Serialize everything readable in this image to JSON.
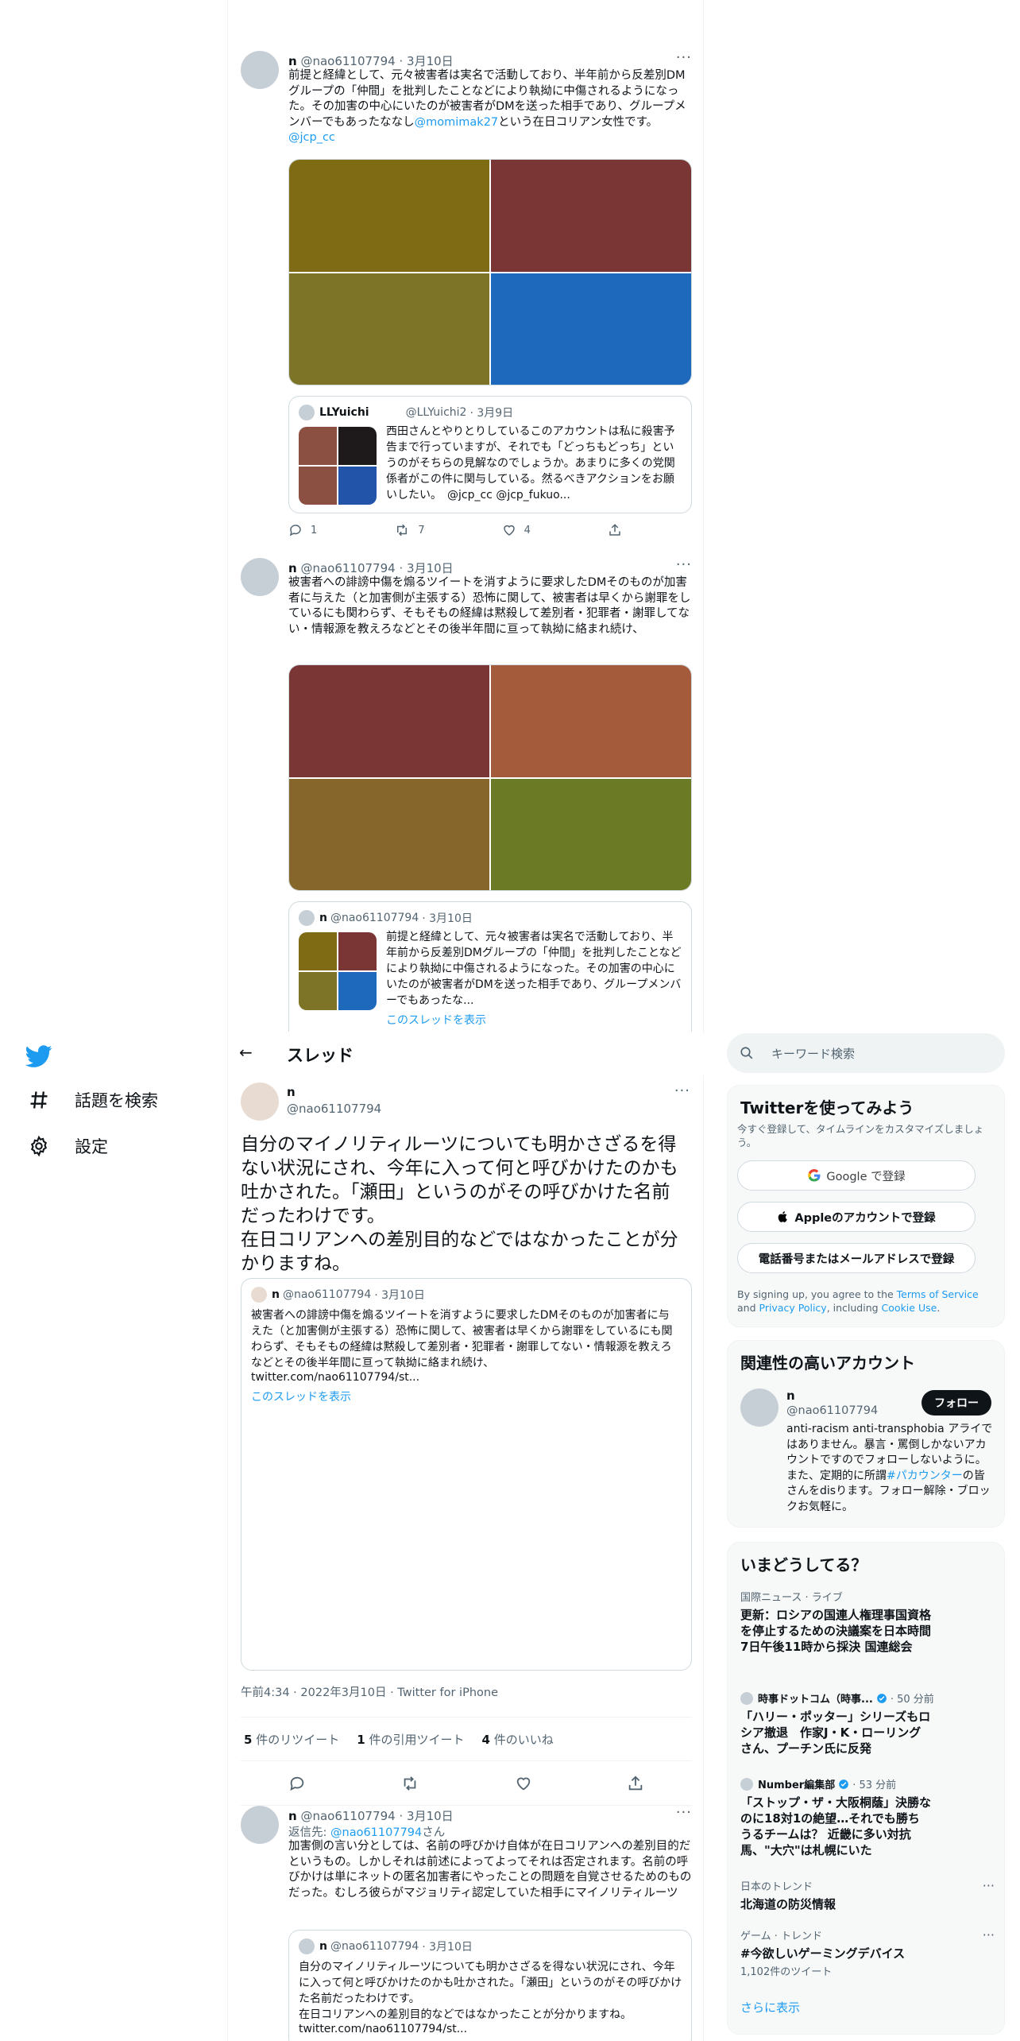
{
  "nav": {
    "explore_label": "話題を検索",
    "settings_label": "設定"
  },
  "tweet1": {
    "name": "n",
    "handle": "@nao61107794",
    "date": "· 3月10日",
    "more": "···",
    "text_a": "前提と経緯として、元々被害者は実名で活動しており、半年前から反差別DMグループの「仲間」を批判したことなどにより執拗に中傷されるようになった。その加害の中心にいたのが被害者がDMを送った相手であり、グループメンバーでもあったななし",
    "mention": "@momimak27",
    "text_b": "という在日コリアン女性です。",
    "mention2": "@jcp_cc",
    "media_colors": [
      "#7f6b14",
      "#7a3535",
      "#7e7428",
      "#1e69bc"
    ],
    "quote": {
      "name": "LLYuichi",
      "handle": "@LLYuichi2",
      "date": "· 3月9日",
      "text": "西田さんとやりとりしているこのアカウントは私に殺害予告まで行っていますが、それでも「どっちもどっち」というのがそちらの見解なのでしょうか。あまりに多くの党関係者がこの件に関与している。然るべきアクションをお願いしたい。　@jcp_cc @jcp_fukuo...",
      "thumb_colors": [
        "#8c5042",
        "#1e1a1c",
        "#8c5042",
        "#2255aa"
      ]
    },
    "reply_count": "1",
    "retweet_count": "7",
    "like_count": "4"
  },
  "tweet2": {
    "name": "n",
    "handle": "@nao61107794",
    "date": "· 3月10日",
    "more": "···",
    "text": "被害者への誹謗中傷を煽るツイートを消すように要求したDMそのものが加害者に与えた（と加害側が主張する）恐怖に関して、被害者は早くから謝罪をしているにも関わらず、そもそもの経緯は黙殺して差別者・犯罪者・謝罪してない・情報源を教えろなどとその後半年間に亘って執拗に絡まれ続け、",
    "media_colors": [
      "#7a3535",
      "#a35b3c",
      "#86662a",
      "#6b7a25"
    ],
    "quote": {
      "name": "n",
      "handle": "@nao61107794",
      "date": "· 3月10日",
      "text": "前提と経緯として、元々被害者は実名で活動しており、半年前から反差別DMグループの「仲間」を批判したことなどにより執拗に中傷されるようになった。その加害の中心にいたのが被害者がDMを送った相手であり、グループメンバーでもあったな...",
      "show_thread": "このスレッドを表示",
      "thumb_colors": [
        "#7f6b14",
        "#7a3535",
        "#7e7428",
        "#1e69bc"
      ]
    }
  },
  "thread": {
    "back": "←",
    "title": "スレッド",
    "author_name": "n",
    "author_handle": "@nao61107794",
    "more": "···",
    "text": "自分のマイノリティルーツについても明かさざるを得ない状況にされ、今年に入って何と呼びかけたのかも吐かされた。「瀬田」というのがその呼びかけた名前だったわけです。\n在日コリアンへの差別目的などではなかったことが分かりますね。",
    "quote": {
      "name": "n",
      "handle": "@nao61107794",
      "date": "· 3月10日",
      "text": "被害者への誹謗中傷を煽るツイートを消すように要求したDMそのものが加害者に与えた（と加害側が主張する）恐怖に関して、被害者は早くから謝罪をしているにも関わらず、そもそもの経緯は黙殺して差別者・犯罪者・謝罪してない・情報源を教えろなどとその後半年間に亘って執拗に絡まれ続け、",
      "link": "twitter.com/nao61107794/st...",
      "show_thread": "このスレッドを表示"
    },
    "timestamp": "午前4:34 · 2022年3月10日 · Twitter for iPhone",
    "retweets_num": "5",
    "retweets_label": "件のリツイート",
    "quotes_num": "1",
    "quotes_label": "件の引用ツイート",
    "likes_num": "4",
    "likes_label": "件のいいね"
  },
  "reply": {
    "name": "n",
    "handle": "@nao61107794",
    "date": "· 3月10日",
    "more": "···",
    "reply_to_label": "返信先: ",
    "reply_to_handle": "@nao61107794",
    "reply_to_suffix": "さん",
    "text": "加害側の言い分としては、名前の呼びかけ自体が在日コリアンへの差別目的だというもの。しかしそれは前述によってよってそれは否定されます。名前の呼びかけは単にネットの匿名加害者にやったことの問題を自覚させるためのものだった。むしろ彼らがマジョリティ認定していた相手にマイノリティルーツ",
    "quote": {
      "name": "n",
      "handle": "@nao61107794",
      "date": "· 3月10日",
      "text": "自分のマイノリティルーツについても明かさざるを得ない状況にされ、今年に入って何と呼びかけたのかも吐かされた。「瀬田」というのがその呼びかけた名前だったわけです。\n在日コリアンへの差別目的などではなかったことが分かりますね。",
      "link": "twitter.com/nao61107794/st..."
    }
  },
  "sidebar": {
    "search_placeholder": "キーワード検索",
    "signup": {
      "title": "Twitterを使ってみよう",
      "subtitle": "今すぐ登録して、タイムラインをカスタマイズしましょう。",
      "google": "Google で登録",
      "apple": "Appleのアカウントで登録",
      "phone": "電話番号またはメールアドレスで登録",
      "legal_a": "By signing up, you agree to the ",
      "terms": "Terms of Service",
      "legal_b": " and ",
      "privacy": "Privacy Policy",
      "legal_c": ", including ",
      "cookie": "Cookie Use",
      "legal_d": "."
    },
    "related": {
      "title": "関連性の高いアカウント",
      "name": "n",
      "handle": "@nao61107794",
      "follow": "フォロー",
      "bio_a": "anti-racism anti-transphobia アライではありません。暴言・罵倒しかないアカウントですのでフォローしないように。また、定期的に所謂",
      "bio_tag": "#パカウンター",
      "bio_b": "の皆さんをdisります。フォロー解除・ブロックお気軽に。"
    },
    "trends": {
      "title": "いまどうしてる？",
      "items": [
        {
          "meta": "国際ニュース · ライブ",
          "title": "更新：ロシアの国連人権理事国資格を停止するための決議案を日本時間7日午後11時から採決 国連総会"
        },
        {
          "source": "時事ドットコム（時事...",
          "time": "· 50 分前",
          "title": "「ハリー・ポッター」シリーズもロシア撤退　作家J・K・ローリングさん、プーチン氏に反発"
        },
        {
          "source": "Number編集部",
          "time": "· 53 分前",
          "title": "「ストップ・ザ・大阪桐蔭」決勝なのに18対1の絶望…それでも勝ちうるチームは？ 近畿に多い対抗馬、\"大穴\"は札幌にいた"
        },
        {
          "meta": "日本のトレンド",
          "title": "北海道の防災情報"
        },
        {
          "meta": "ゲーム · トレンド",
          "title": "#今欲しいゲーミングデバイス",
          "count": "1,102件のツイート"
        }
      ],
      "more": "さらに表示"
    }
  }
}
